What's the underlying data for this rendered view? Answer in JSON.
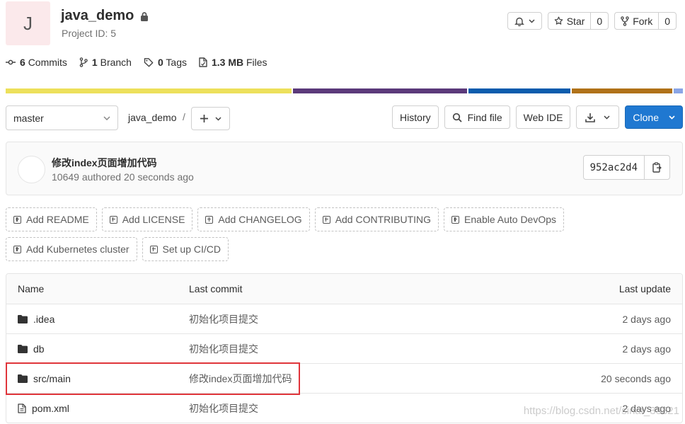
{
  "project": {
    "avatar_letter": "J",
    "name": "java_demo",
    "id_text": "Project ID: 5"
  },
  "top_buttons": {
    "star_label": "Star",
    "star_count": "0",
    "fork_label": "Fork",
    "fork_count": "0"
  },
  "stats": {
    "commits_count": "6",
    "commits_label": "Commits",
    "branch_count": "1",
    "branch_label": "Branch",
    "tags_count": "0",
    "tags_label": "Tags",
    "files_size": "1.3 MB",
    "files_label": "Files"
  },
  "language_bar": [
    {
      "color": "#ede05b",
      "share": 0.426
    },
    {
      "color": "#5b3a7a",
      "share": 0.259
    },
    {
      "color": "#0b5cad",
      "share": 0.152
    },
    {
      "color": "#b07219",
      "share": 0.149
    },
    {
      "color": "#8aa5e6",
      "share": 0.014
    }
  ],
  "nav": {
    "branch": "master",
    "breadcrumb": "java_demo",
    "separator": "/",
    "history": "History",
    "find_file": "Find file",
    "web_ide": "Web IDE",
    "clone": "Clone"
  },
  "commit": {
    "title": "修改index页面增加代码",
    "meta": "10649 authored 20 seconds ago",
    "sha": "952ac2d4"
  },
  "add_buttons": {
    "row1": [
      "Add README",
      "Add LICENSE",
      "Add CHANGELOG",
      "Add CONTRIBUTING",
      "Enable Auto DevOps"
    ],
    "row2": [
      "Add Kubernetes cluster",
      "Set up CI/CD"
    ]
  },
  "file_table": {
    "headers": {
      "name": "Name",
      "last_commit": "Last commit",
      "last_update": "Last update"
    },
    "rows": [
      {
        "name": ".idea",
        "type": "folder",
        "commit": "初始化项目提交",
        "updated": "2 days ago"
      },
      {
        "name": "db",
        "type": "folder",
        "commit": "初始化项目提交",
        "updated": "2 days ago"
      },
      {
        "name": "src/main",
        "type": "folder",
        "commit": "修改index页面增加代码",
        "updated": "20 seconds ago"
      },
      {
        "name": "pom.xml",
        "type": "file",
        "commit": "初始化项目提交",
        "updated": "2 days ago"
      }
    ]
  },
  "watermark": "https://blog.csdn.net/sinat_33321"
}
